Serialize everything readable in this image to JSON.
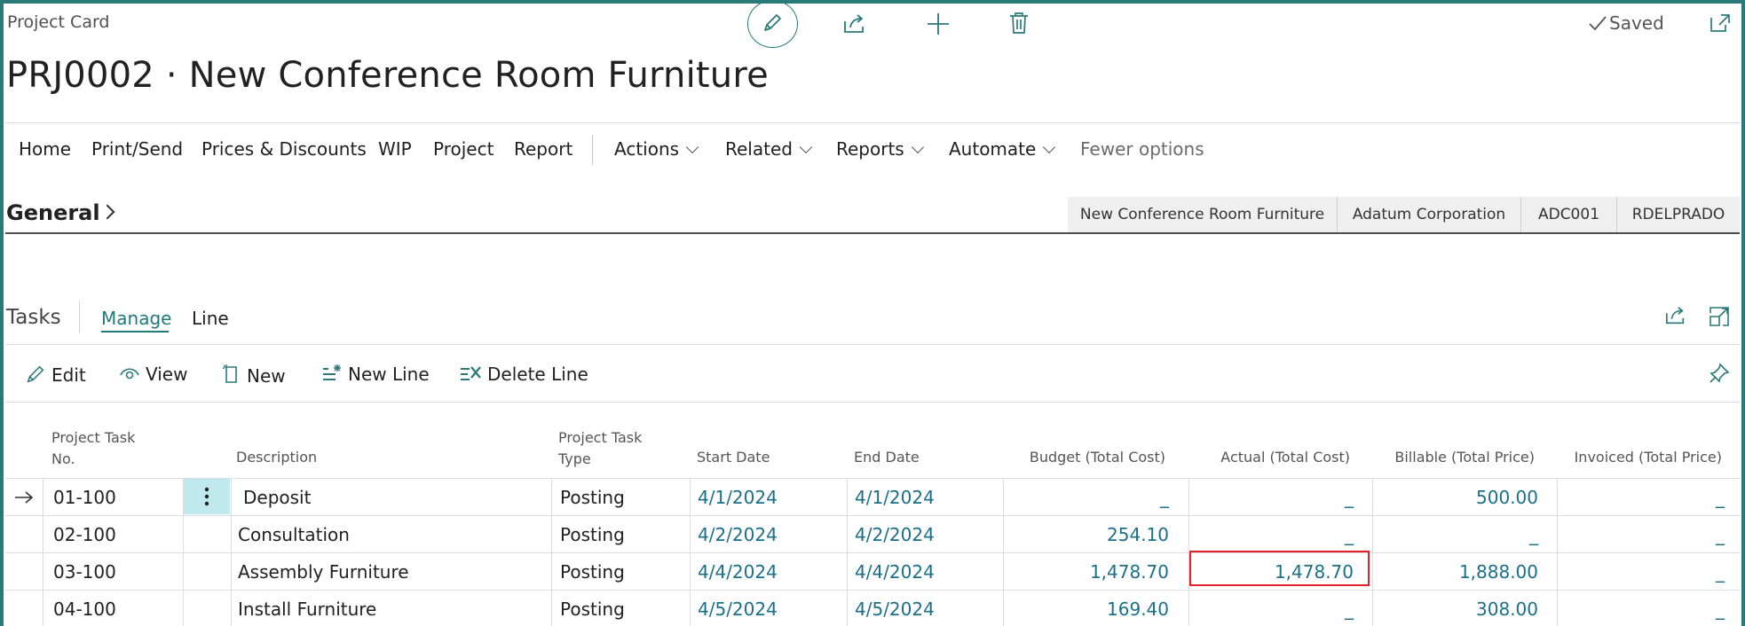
{
  "header": {
    "caption": "Project Card",
    "title": "PRJ0002 · New Conference Room Furniture",
    "saved_label": "Saved",
    "icons": [
      "edit-pencil-icon",
      "share-icon",
      "plus-icon",
      "delete-icon",
      "expand-icon"
    ]
  },
  "menu": {
    "items": [
      "Home",
      "Print/Send",
      "Prices & Discounts",
      "WIP",
      "Project",
      "Report"
    ],
    "dropdowns": [
      "Actions",
      "Related",
      "Reports",
      "Automate"
    ],
    "fewer_options": "Fewer options"
  },
  "general": {
    "label": "General",
    "chips": [
      "New Conference Room Furniture",
      "Adatum Corporation",
      "ADC001",
      "RDELPRADO"
    ]
  },
  "tasks": {
    "label": "Tasks",
    "tabs": [
      "Manage",
      "Line"
    ],
    "active_tab": "Manage",
    "toolbar": [
      "Edit",
      "View",
      "New",
      "New Line",
      "Delete Line"
    ]
  },
  "table": {
    "headers": {
      "task_no_1": "Project Task",
      "task_no_2": "No.",
      "description": "Description",
      "type_1": "Project Task",
      "type_2": "Type",
      "start": "Start Date",
      "end": "End Date",
      "budget": "Budget (Total Cost)",
      "actual": "Actual (Total Cost)",
      "billable": "Billable (Total Price)",
      "invoiced": "Invoiced (Total Price)"
    },
    "rows": [
      {
        "no": "01-100",
        "description": "Deposit",
        "type": "Posting",
        "start": "4/1/2024",
        "end": "4/1/2024",
        "budget": "_",
        "actual": "_",
        "billable": "500.00",
        "invoiced": "_"
      },
      {
        "no": "02-100",
        "description": "Consultation",
        "type": "Posting",
        "start": "4/2/2024",
        "end": "4/2/2024",
        "budget": "254.10",
        "actual": "_",
        "billable": "_",
        "invoiced": "_"
      },
      {
        "no": "03-100",
        "description": "Assembly Furniture",
        "type": "Posting",
        "start": "4/4/2024",
        "end": "4/4/2024",
        "budget": "1,478.70",
        "actual": "1,478.70",
        "billable": "1,888.00",
        "invoiced": "_"
      },
      {
        "no": "04-100",
        "description": "Install Furniture",
        "type": "Posting",
        "start": "4/5/2024",
        "end": "4/5/2024",
        "budget": "169.40",
        "actual": "_",
        "billable": "308.00",
        "invoiced": "_"
      }
    ]
  },
  "colors": {
    "accent": "#1f7a7b",
    "frame": "#2b7a7b",
    "highlight": "#e1222a",
    "value": "#1a6f8a"
  }
}
